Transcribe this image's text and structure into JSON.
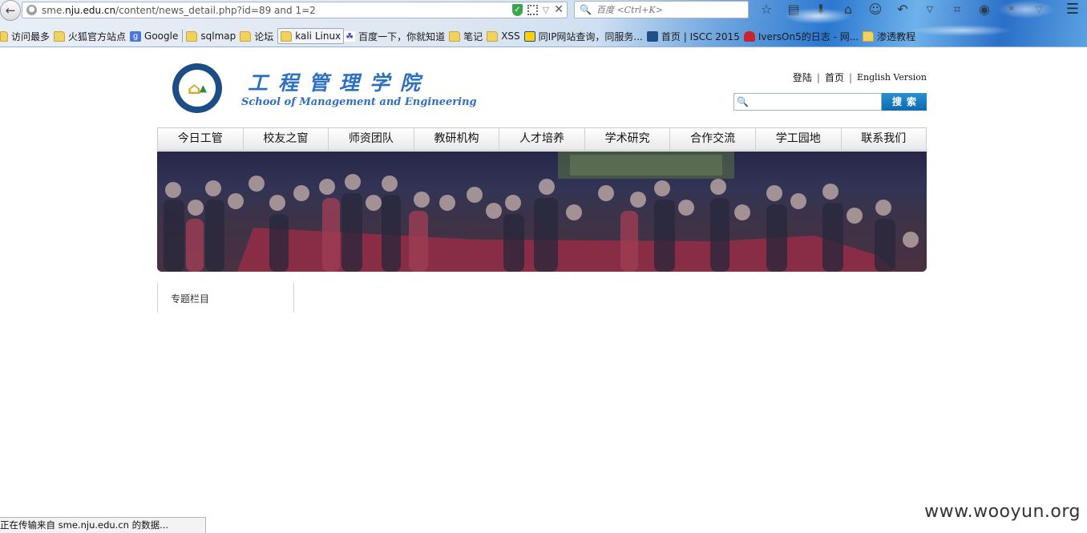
{
  "browser": {
    "url_prefix": "sme.",
    "url_domain": "nju.edu.cn",
    "url_path": "/content/news_detail.php?id=89 and 1=2",
    "search_placeholder": "百度 <Ctrl+K>",
    "bookmarks": [
      {
        "label": "访问最多",
        "icon": "folder"
      },
      {
        "label": "火狐官方站点",
        "icon": "folder"
      },
      {
        "label": "Google",
        "icon": "google"
      },
      {
        "label": "sqlmap",
        "icon": "folder"
      },
      {
        "label": "论坛",
        "icon": "folder"
      },
      {
        "label": "kali Linux",
        "icon": "folder"
      },
      {
        "label": "百度一下，你就知道",
        "icon": "baidu-paw"
      },
      {
        "label": "笔记",
        "icon": "folder"
      },
      {
        "label": "XSS",
        "icon": "folder"
      },
      {
        "label": "同IP网站查询，同服务...",
        "icon": "ip"
      },
      {
        "label": "首页 | ISCC 2015",
        "icon": "iscc"
      },
      {
        "label": "IversOn5的日志 - 网...",
        "icon": "red"
      },
      {
        "label": "渗透教程",
        "icon": "folder"
      }
    ],
    "status_text": "正在传输来自 sme.nju.edu.cn 的数据..."
  },
  "site": {
    "title_cn": "工程管理学院",
    "title_en": "School of Management and Engineering",
    "top_links": {
      "login": "登陆",
      "home": "首页",
      "english": "English Version"
    },
    "search_button": "搜索",
    "nav": [
      "今日工管",
      "校友之窗",
      "师资团队",
      "教研机构",
      "人才培养",
      "学术研究",
      "合作交流",
      "学工园地",
      "联系我们"
    ],
    "sidebar_title": "专题栏目"
  },
  "watermark": "www.wooyun.org"
}
